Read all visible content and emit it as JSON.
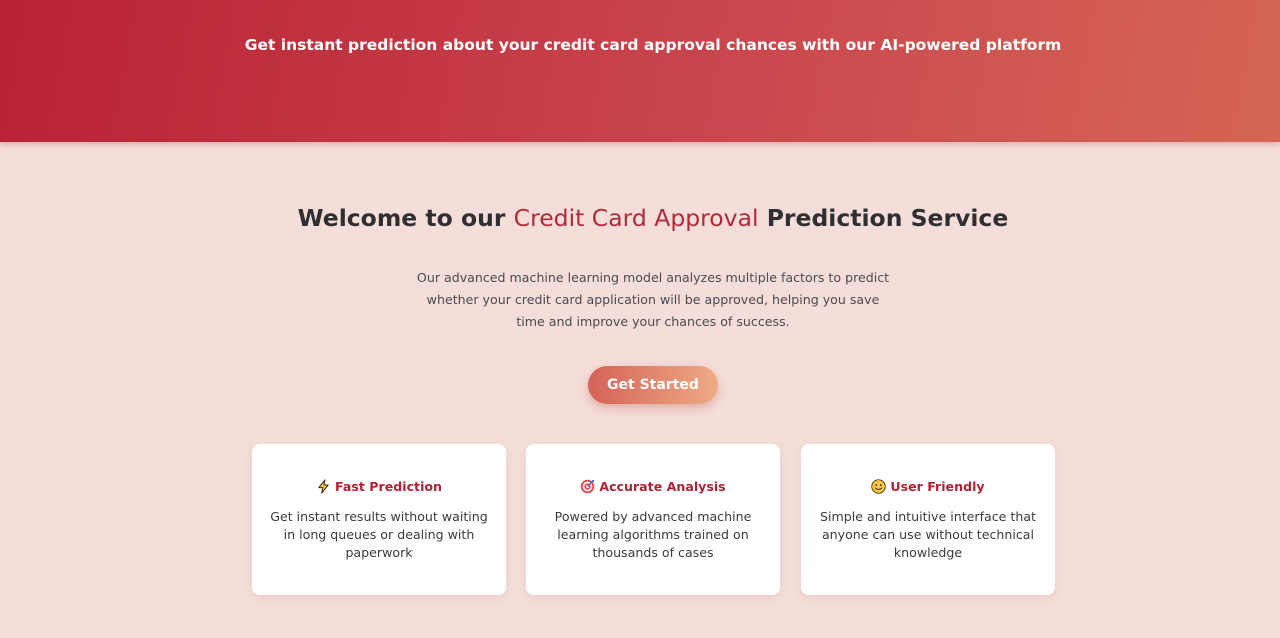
{
  "hero": {
    "tagline": "Get instant prediction about your credit card approval chances with our AI-powered platform"
  },
  "welcome": {
    "title_prefix": "Welcome to our",
    "title_highlight": "Credit Card Approval",
    "title_suffix": "Prediction Service",
    "description": "Our advanced machine learning model analyzes multiple factors to predict whether your credit card application will be approved, helping you save time and improve your chances of success.",
    "cta_label": "Get Started"
  },
  "features": [
    {
      "icon": "lightning-icon",
      "title": "Fast Prediction",
      "text": "Get instant results without waiting in long queues or dealing with paperwork"
    },
    {
      "icon": "target-icon",
      "title": "Accurate Analysis",
      "text": "Powered by advanced machine learning algorithms trained on thousands of cases"
    },
    {
      "icon": "smiley-icon",
      "title": "User Friendly",
      "text": "Simple and intuitive interface that anyone can use without technical knowledge"
    }
  ],
  "colors": {
    "brand_red": "#b92235",
    "accent_text": "#b12a3a",
    "background": "#f5ded9",
    "cta_start": "#d56257",
    "cta_end": "#eeab85"
  }
}
